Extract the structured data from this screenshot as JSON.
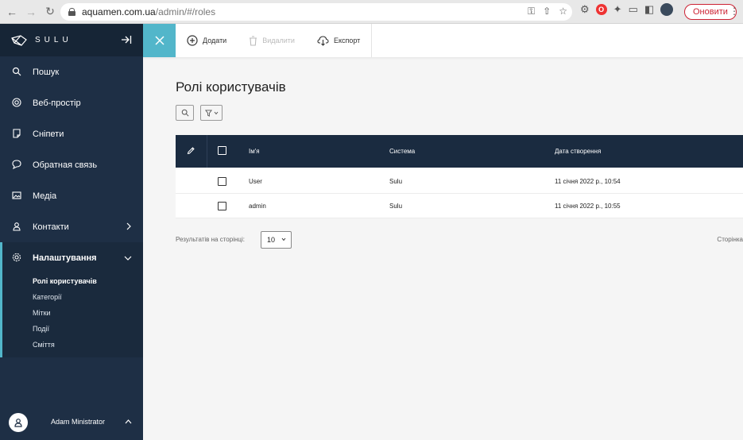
{
  "browser": {
    "url_host": "aquamen.com.ua",
    "url_path": "/admin/#/roles",
    "update_button": "Оновити"
  },
  "sidebar": {
    "logo_text": "SULU",
    "items": [
      {
        "label": "Пошук",
        "icon": "search-icon"
      },
      {
        "label": "Веб-простір",
        "icon": "globe-icon"
      },
      {
        "label": "Сніпети",
        "icon": "snippet-icon"
      },
      {
        "label": "Обратная связь",
        "icon": "comment-icon"
      },
      {
        "label": "Медіа",
        "icon": "media-icon"
      },
      {
        "label": "Контакти",
        "icon": "contact-icon"
      },
      {
        "label": "Налаштування",
        "icon": "gear-icon"
      }
    ],
    "settings_sub": [
      {
        "label": "Ролі користувачів"
      },
      {
        "label": "Категорії"
      },
      {
        "label": "Мітки"
      },
      {
        "label": "Події"
      },
      {
        "label": "Сміття"
      }
    ],
    "user_name": "Adam Ministrator"
  },
  "toolbar": {
    "add_label": "Додати",
    "delete_label": "Видалити",
    "export_label": "Експорт"
  },
  "main": {
    "title": "Ролі користувачів",
    "columns": {
      "name": "Ім'я",
      "system": "Система",
      "created": "Дата створення"
    },
    "rows": [
      {
        "name": "User",
        "system": "Sulu",
        "created": "11 січня 2022 р., 10:54"
      },
      {
        "name": "admin",
        "system": "Sulu",
        "created": "11 січня 2022 р., 10:55"
      }
    ],
    "per_page_label": "Результатів на сторінці:",
    "per_page_value": "10",
    "page_label": "Сторінка"
  },
  "colors": {
    "accent": "#52b6ca",
    "sidebar": "#1e2f45",
    "table_header": "#1a2b40"
  }
}
